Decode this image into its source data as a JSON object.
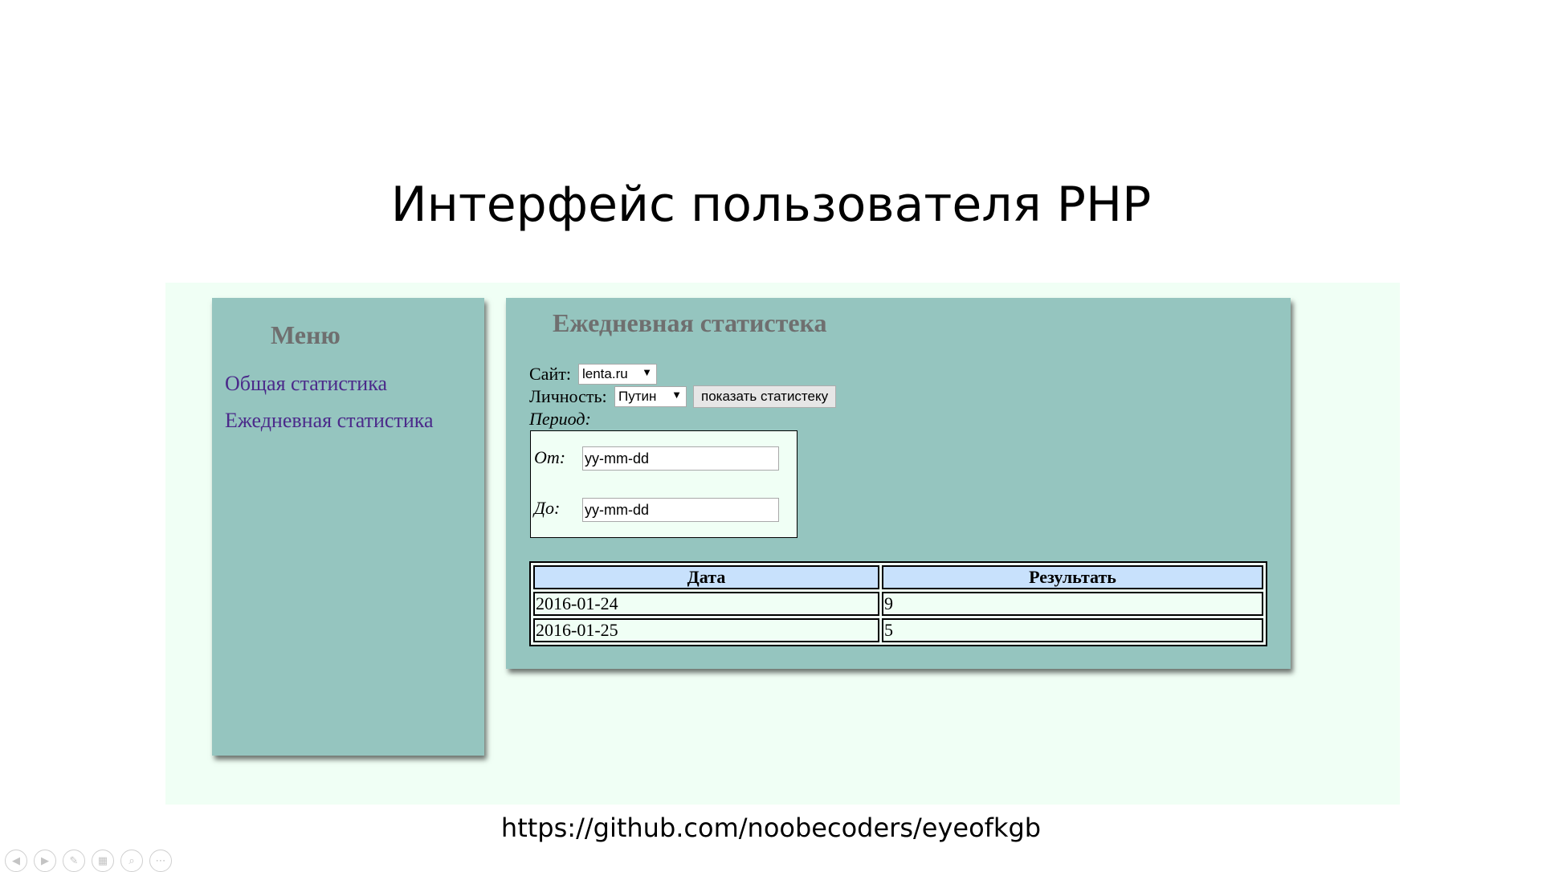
{
  "slide": {
    "title": "Интерфейс пользователя PHP",
    "footer_url": "https://github.com/noobecoders/eyeofkgb"
  },
  "menu": {
    "title": "Меню",
    "items": [
      {
        "label": "Общая статистика"
      },
      {
        "label": "Ежедневная статистика"
      }
    ]
  },
  "main": {
    "title": "Ежедневная статистека",
    "site_label": "Сайт:",
    "site_value": "lenta.ru",
    "person_label": "Личность:",
    "person_value": "Путин",
    "show_button": "показать статистеку",
    "period_label": "Период:",
    "from_label": "От:",
    "from_value": "yy-mm-dd",
    "to_label": "До:",
    "to_value": "yy-mm-dd",
    "table": {
      "headers": [
        "Дата",
        "Результать"
      ],
      "rows": [
        [
          "2016-01-24",
          "9"
        ],
        [
          "2016-01-25",
          "5"
        ]
      ]
    }
  },
  "controls": {
    "icons": [
      "prev-icon",
      "next-icon",
      "pen-icon",
      "slides-icon",
      "zoom-icon",
      "more-icon"
    ]
  },
  "colors": {
    "panel": "#95c5bf",
    "page_bg": "#f0fff5",
    "table_header": "#c8e1fc",
    "link": "#4b2a8a"
  }
}
